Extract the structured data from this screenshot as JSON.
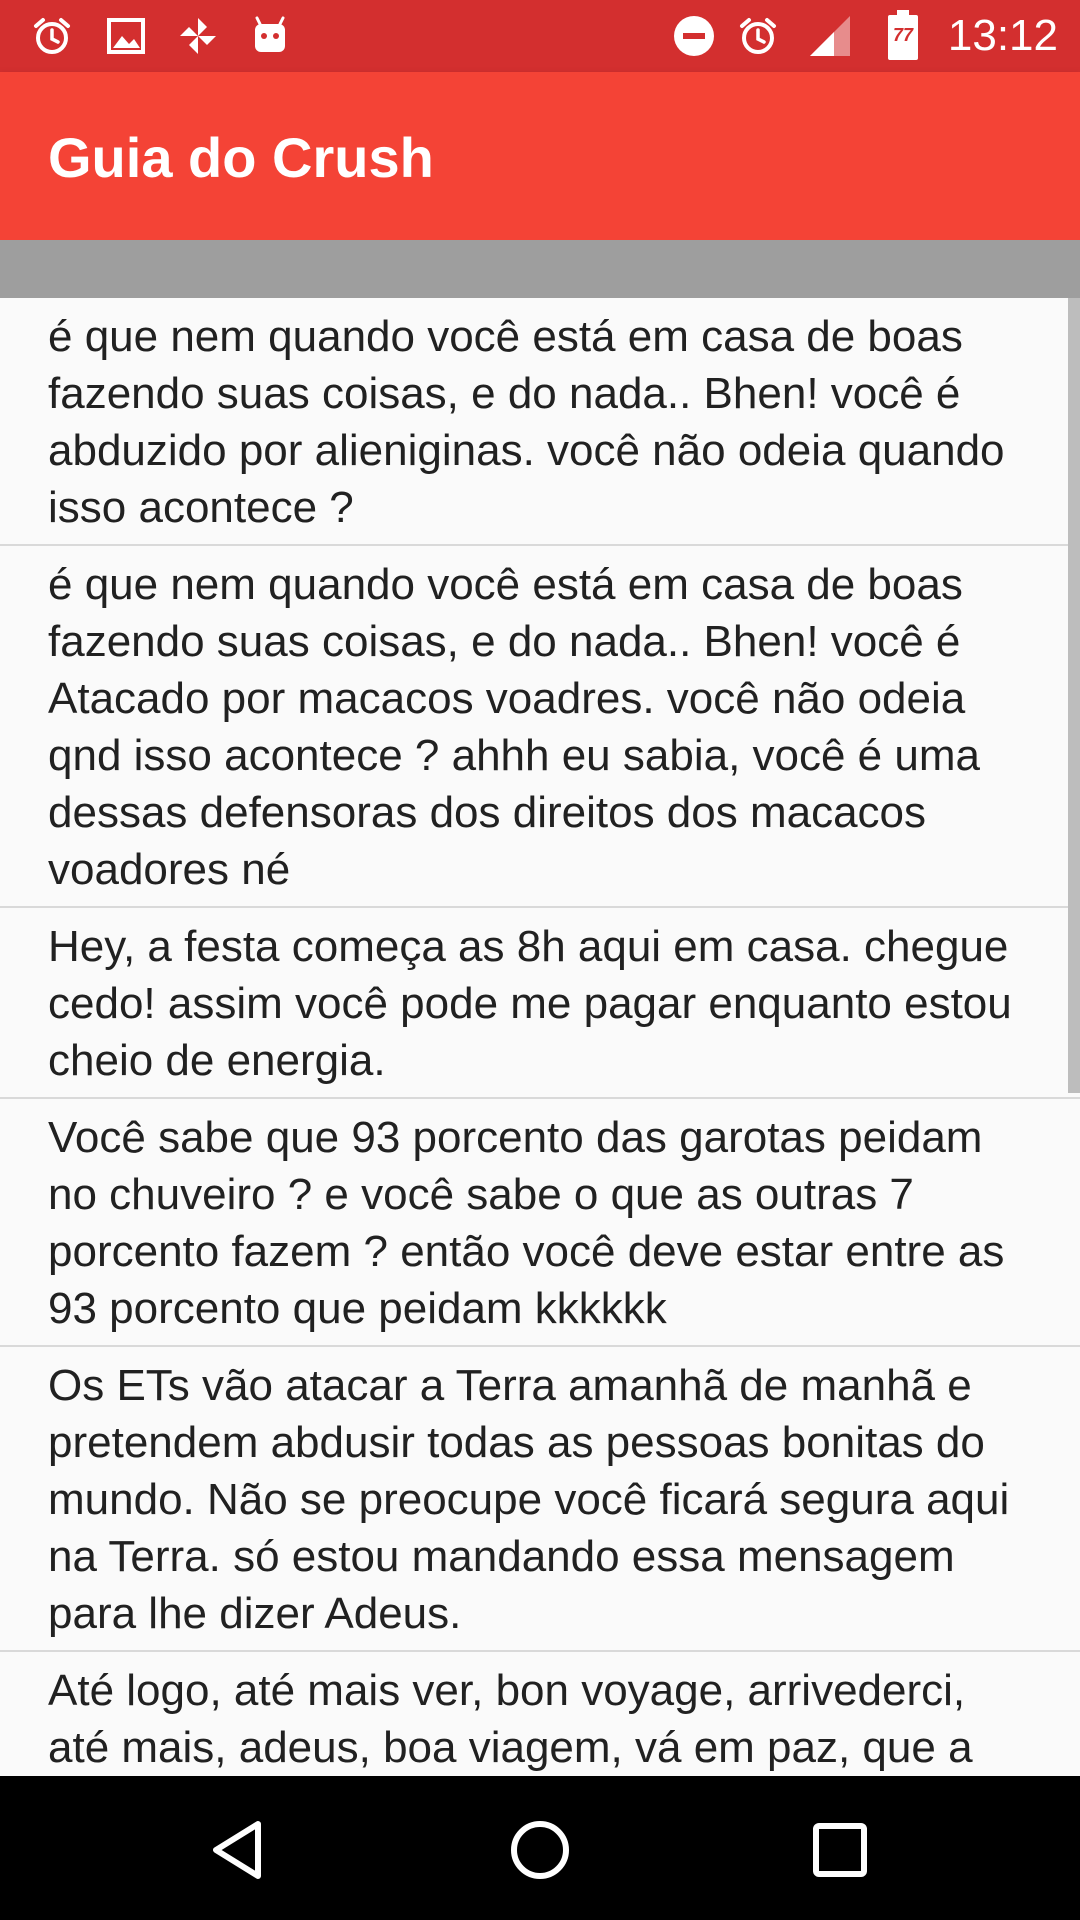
{
  "status_bar": {
    "time": "13:12",
    "left_icons": [
      "alarm-icon",
      "image-icon",
      "pinwheel-icon",
      "android-icon"
    ],
    "right_icons": [
      "do-not-disturb-icon",
      "alarm-icon",
      "signal-icon",
      "battery-icon"
    ],
    "battery_level": "77",
    "background": "#d32f2f"
  },
  "app_bar": {
    "title": "Guia do Crush",
    "background": "#f44336"
  },
  "messages": [
    "é que nem quando você está em casa de boas fazendo suas coisas, e do nada.. Bhen! você é abduzido por alieniginas. você não odeia quando isso acontece ?",
    "é que nem quando você está em casa de boas fazendo suas coisas, e do nada.. Bhen! você é Atacado por macacos voadres. você não odeia qnd isso acontece ? ahhh eu sabia, você é uma dessas defensoras dos direitos dos macacos voadores né",
    "Hey, a festa começa as 8h aqui em casa. chegue cedo! assim você pode me pagar enquanto estou cheio de energia.",
    "Você sabe que 93 porcento das garotas peidam no chuveiro ? e você sabe o que as outras 7 porcento fazem ? então você deve estar entre as 93 porcento que peidam kkkkkk",
    "Os ETs vão atacar a Terra amanhã de manhã e pretendem abdusir todas as pessoas bonitas do mundo. Não se preocupe você ficará segura aqui na Terra. só estou mandando essa mensagem para lhe dizer Adeus.",
    "Até logo, até mais ver, bon voyage, arrivederci, até mais, adeus, boa viagem, vá em paz, que a"
  ],
  "nav_bar": {
    "back": "back-icon",
    "home": "home-icon",
    "recents": "recents-icon"
  }
}
